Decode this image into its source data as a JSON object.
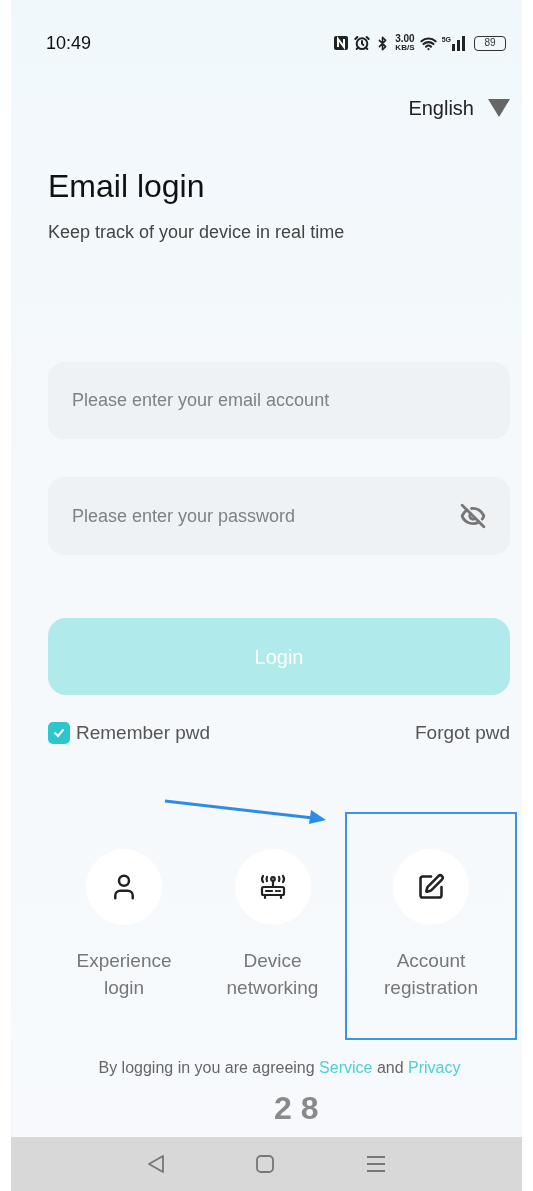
{
  "status_bar": {
    "time": "10:49",
    "speed_value": "3.00",
    "speed_unit": "KB/S",
    "network": "5G",
    "battery": "89"
  },
  "language": {
    "label": "English"
  },
  "title": "Email login",
  "subtitle": "Keep track of your device in real time",
  "email_field": {
    "placeholder": "Please enter your email account"
  },
  "password_field": {
    "placeholder": "Please enter your password",
    "visible": false
  },
  "login_button": {
    "label": "Login",
    "disabled": true
  },
  "remember": {
    "label": "Remember pwd",
    "checked": true
  },
  "forgot": {
    "label": "Forgot pwd"
  },
  "shortcuts": [
    {
      "kind": "user",
      "label_lines": [
        "Experience",
        "login"
      ],
      "highlighted": false
    },
    {
      "kind": "router",
      "label_lines": [
        "Device",
        "networking"
      ],
      "highlighted": false
    },
    {
      "kind": "edit",
      "label_lines": [
        "Account",
        "registration"
      ],
      "highlighted": true
    }
  ],
  "agreement": {
    "text": "By logging in you are agreeing",
    "service_link": "Service",
    "conjunction": "and",
    "privacy_link": "Privacy"
  },
  "page_number": "2 8"
}
